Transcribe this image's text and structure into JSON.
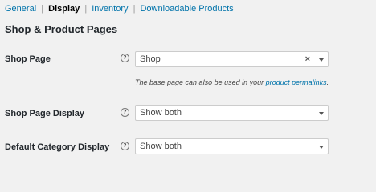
{
  "tabs": {
    "general": "General",
    "display": "Display",
    "inventory": "Inventory",
    "downloadable": "Downloadable Products",
    "separator": "|"
  },
  "section_title": "Shop & Product Pages",
  "fields": {
    "shop_page": {
      "label": "Shop Page",
      "value": "Shop",
      "clear": "×"
    },
    "shop_page_display": {
      "label": "Shop Page Display",
      "value": "Show both"
    },
    "default_category_display": {
      "label": "Default Category Display",
      "value": "Show both"
    }
  },
  "description": {
    "text": "The base page can also be used in your ",
    "link": "product permalinks",
    "suffix": "."
  },
  "help_glyph": "?"
}
